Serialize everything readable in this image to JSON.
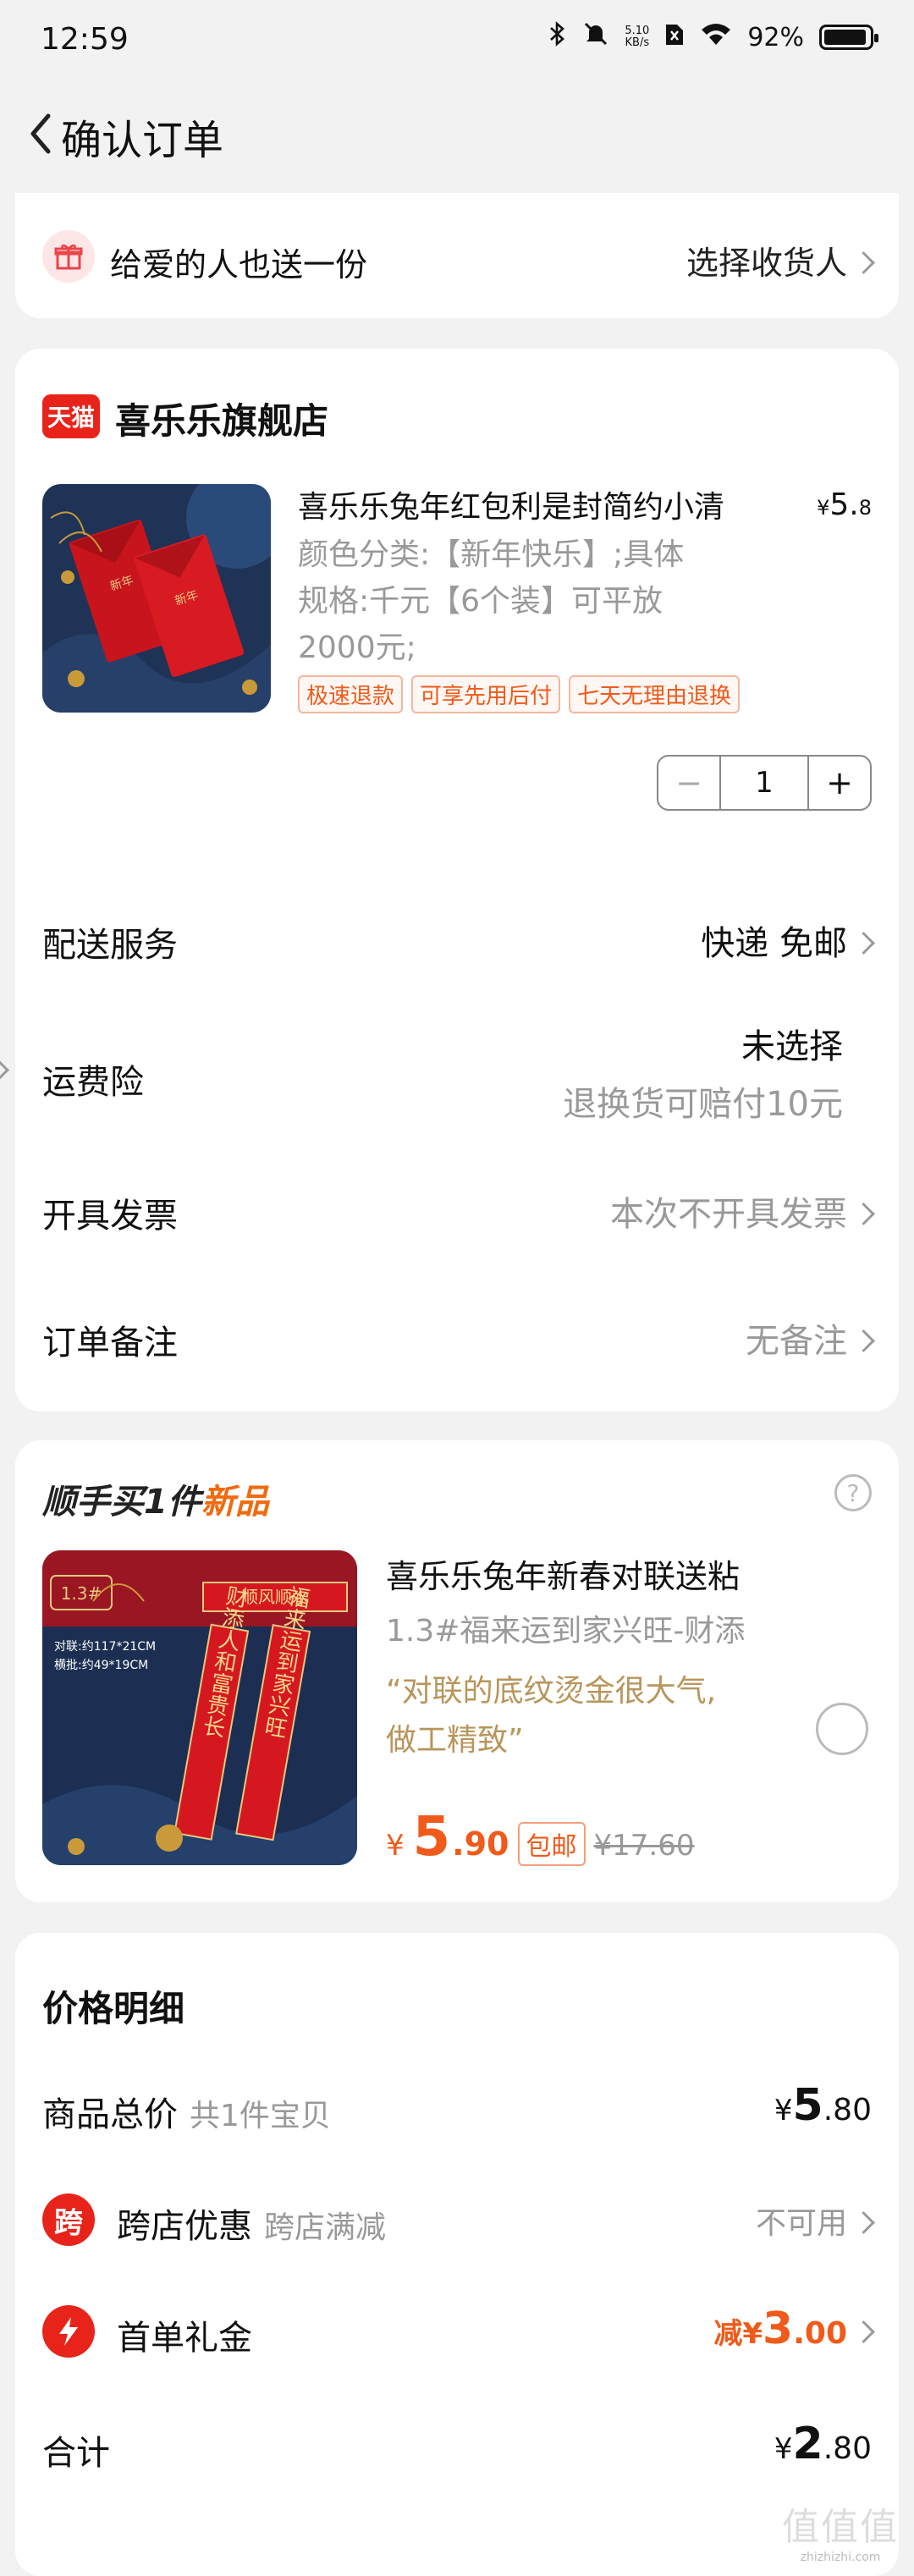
{
  "status_bar": {
    "time": "12:59",
    "net_speed_top": "5.10",
    "net_speed_bottom": "KB/s",
    "battery": "92%"
  },
  "nav": {
    "title": "确认订单"
  },
  "gift": {
    "label": "给爱的人也送一份",
    "action": "选择收货人"
  },
  "store": {
    "badge": "天猫",
    "name": "喜乐乐旗舰店",
    "product": {
      "title": "喜乐乐兔年红包利是封简约小清",
      "price_symbol": "¥",
      "price_int": "5.",
      "price_dec": "8",
      "spec_lines": [
        "颜色分类:【新年快乐】;具体",
        "规格:千元【6个装】可平放",
        "2000元;"
      ],
      "tags": [
        "极速退款",
        "可享先用后付",
        "七天无理由退换"
      ],
      "quantity": "1"
    },
    "rows": {
      "delivery": {
        "label": "配送服务",
        "value": "快递 免邮"
      },
      "insurance": {
        "label": "运费险",
        "value": "未选择",
        "sub": "退换货可赔付10元"
      },
      "invoice": {
        "label": "开具发票",
        "value": "本次不开具发票"
      },
      "note": {
        "label": "订单备注",
        "value": "无备注"
      }
    }
  },
  "recommend": {
    "title": "顺手买1件",
    "title_tag": "新品",
    "help": "?",
    "name": "喜乐乐兔年新春对联送粘",
    "sub": "1.3#福来运到家兴旺-财添",
    "quote_1": "“对联的底纹烫金很大气,",
    "quote_2": "做工精致”",
    "price_symbol": "¥",
    "price_int": "5",
    "price_dec": ".90",
    "badge": "包邮",
    "original_price": "¥17.60",
    "img_tag": "1.3#",
    "img_spec_1": "对联:约117*21CM",
    "img_spec_2": "横批:约49*19CM",
    "img_hengpi": "顺风顺水",
    "img_couplet_left": "财添人和富贵长",
    "img_couplet_right": "福来运到家兴旺"
  },
  "price_detail": {
    "title": "价格明细",
    "total": {
      "label": "商品总价",
      "sub": "共1件宝贝",
      "y": "¥",
      "i": "5",
      "d": ".80"
    },
    "cross": {
      "icon": "跨",
      "label": "跨店优惠",
      "sub": "跨店满减",
      "value": "不可用"
    },
    "first": {
      "label": "首单礼金",
      "prefix": "减",
      "y": "¥",
      "i": "3",
      "d": ".00"
    },
    "sum": {
      "label": "合计",
      "y": "¥",
      "i": "2",
      "d": ".80"
    }
  },
  "watermark": {
    "big": "值值值",
    "small": "zhizhizhi.com"
  },
  "colors": {
    "accent": "#f05a1a",
    "tmall_red": "#e8231a",
    "gold": "#b8955a"
  }
}
